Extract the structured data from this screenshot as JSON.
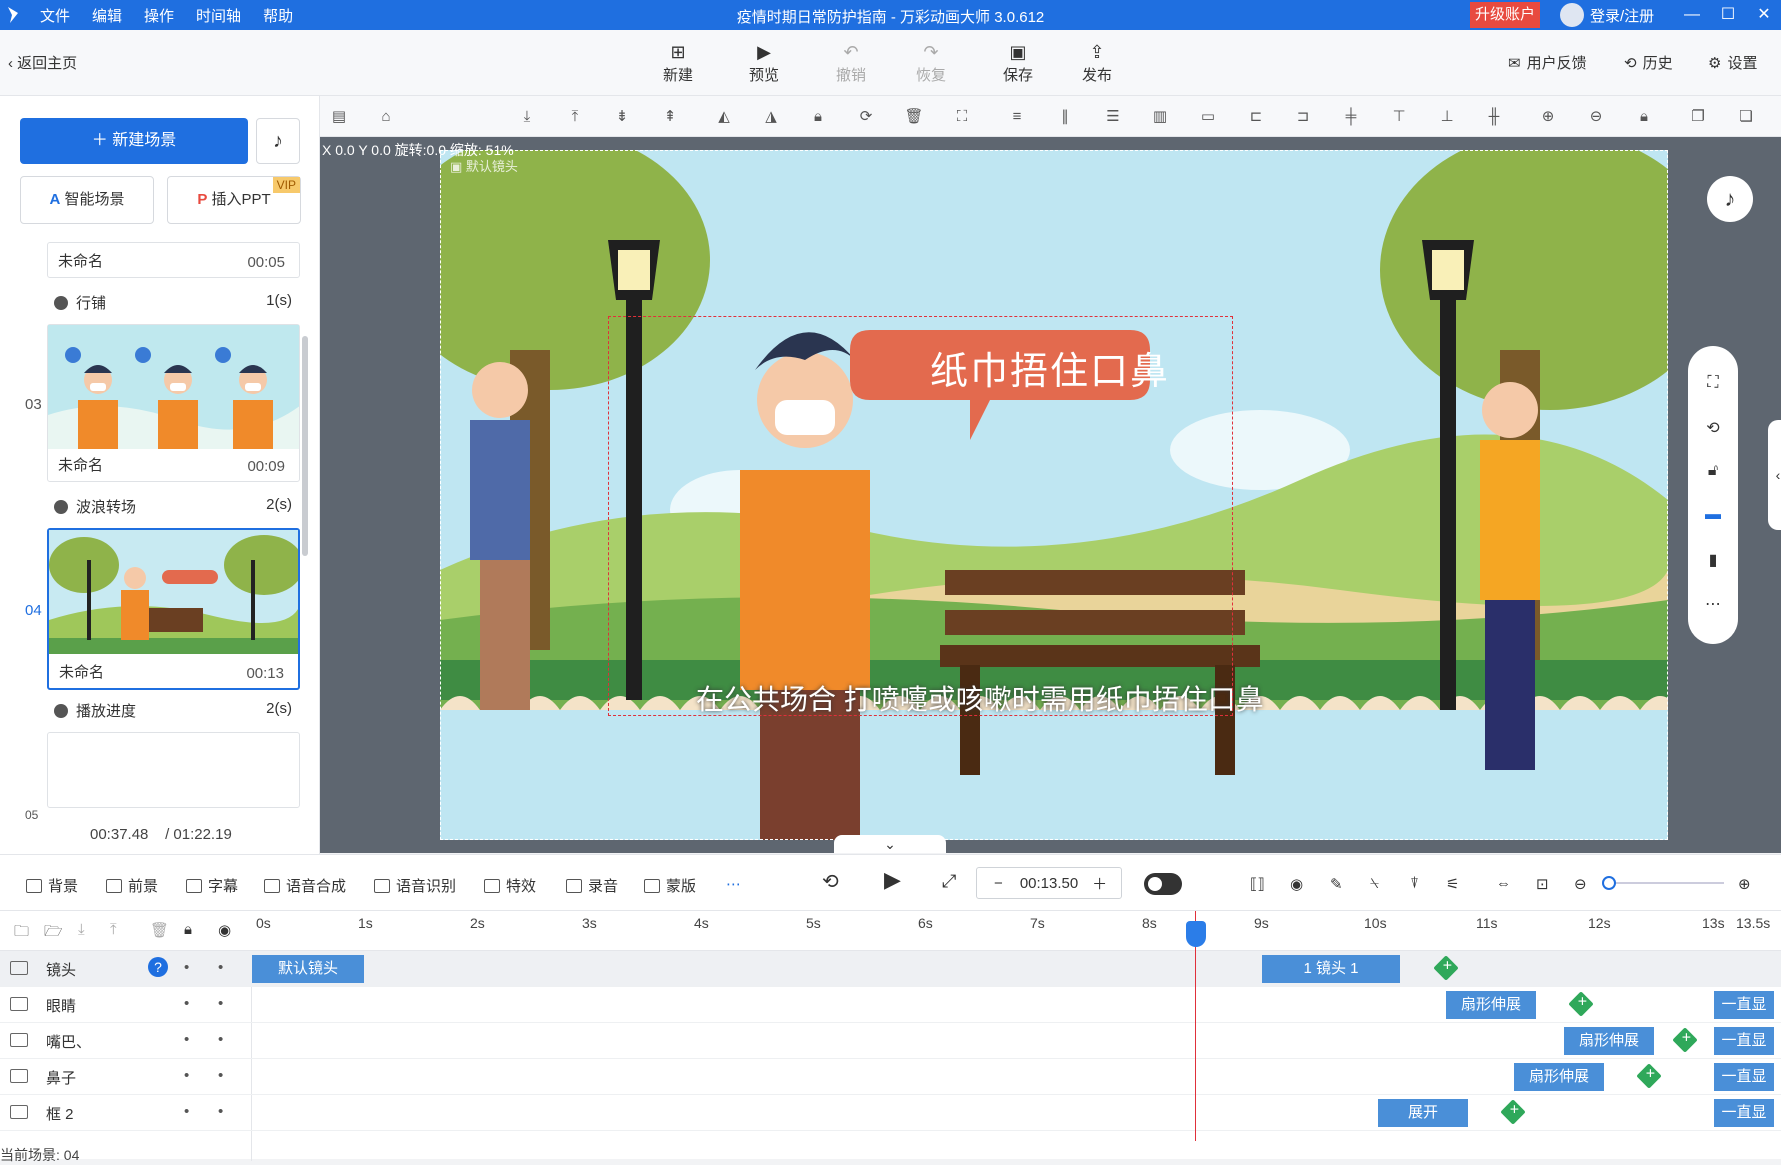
{
  "titlebar": {
    "menu": [
      "文件",
      "编辑",
      "操作",
      "时间轴",
      "帮助"
    ],
    "title": "疫情时期日常防护指南 - 万彩动画大师 3.0.612",
    "upgrade": "升级账户",
    "login": "登录/注册"
  },
  "toolbar": {
    "back": "返回主页",
    "new": "新建",
    "preview": "预览",
    "undo": "撤销",
    "redo": "恢复",
    "save": "保存",
    "publish": "发布",
    "feedback": "用户反馈",
    "history": "历史",
    "settings": "设置"
  },
  "leftpanel": {
    "new_scene": "新建场景",
    "smart_scene": "智能场景",
    "insert_ppt": "插入PPT",
    "vip": "VIP",
    "scenes": [
      {
        "name": "未命名",
        "duration": "00:05"
      },
      {
        "index": "03",
        "name": "未命名",
        "duration": "00:09"
      },
      {
        "index": "04",
        "name": "未命名",
        "duration": "00:13"
      },
      {
        "index": "05"
      }
    ],
    "transitions": [
      {
        "name": "行铺",
        "time": "1(s)"
      },
      {
        "name": "波浪转场",
        "time": "2(s)"
      },
      {
        "name": "播放进度",
        "time": "2(s)"
      }
    ],
    "time_current": "00:37.48",
    "time_total": "/ 01:22.19"
  },
  "canvas": {
    "coords": "X 0.0  Y 0.0  旋转:0.0  缩放: 51%",
    "camera_label": "默认镜头",
    "speech": "纸巾捂住口鼻",
    "subtitle": "在公共场合 打喷嚏或咳嗽时需用纸巾捂住口鼻"
  },
  "ctrlbar": {
    "items": [
      "背景",
      "前景",
      "字幕",
      "语音合成",
      "语音识别",
      "特效",
      "录音",
      "蒙版"
    ],
    "time": "00:13.50"
  },
  "timeline": {
    "ticks": [
      "0s",
      "1s",
      "2s",
      "3s",
      "4s",
      "5s",
      "6s",
      "7s",
      "8s",
      "9s",
      "10s",
      "11s",
      "12s",
      "13s",
      "13.5s"
    ],
    "tracks": [
      {
        "name": "镜头"
      },
      {
        "name": "眼睛"
      },
      {
        "name": "嘴巴、"
      },
      {
        "name": "鼻子"
      },
      {
        "name": "框 2"
      }
    ],
    "clips": {
      "default_cam": "默认镜头",
      "cam1": "1 镜头 1",
      "fan": "扇形伸展",
      "always": "一直显",
      "expand": "展开"
    },
    "current_scene": "当前场景: 04"
  },
  "colors": {
    "accent": "#1f6fe0",
    "upgrade": "#e84a3f",
    "keyframe": "#2fa85a",
    "playhead": "#e0303a"
  }
}
